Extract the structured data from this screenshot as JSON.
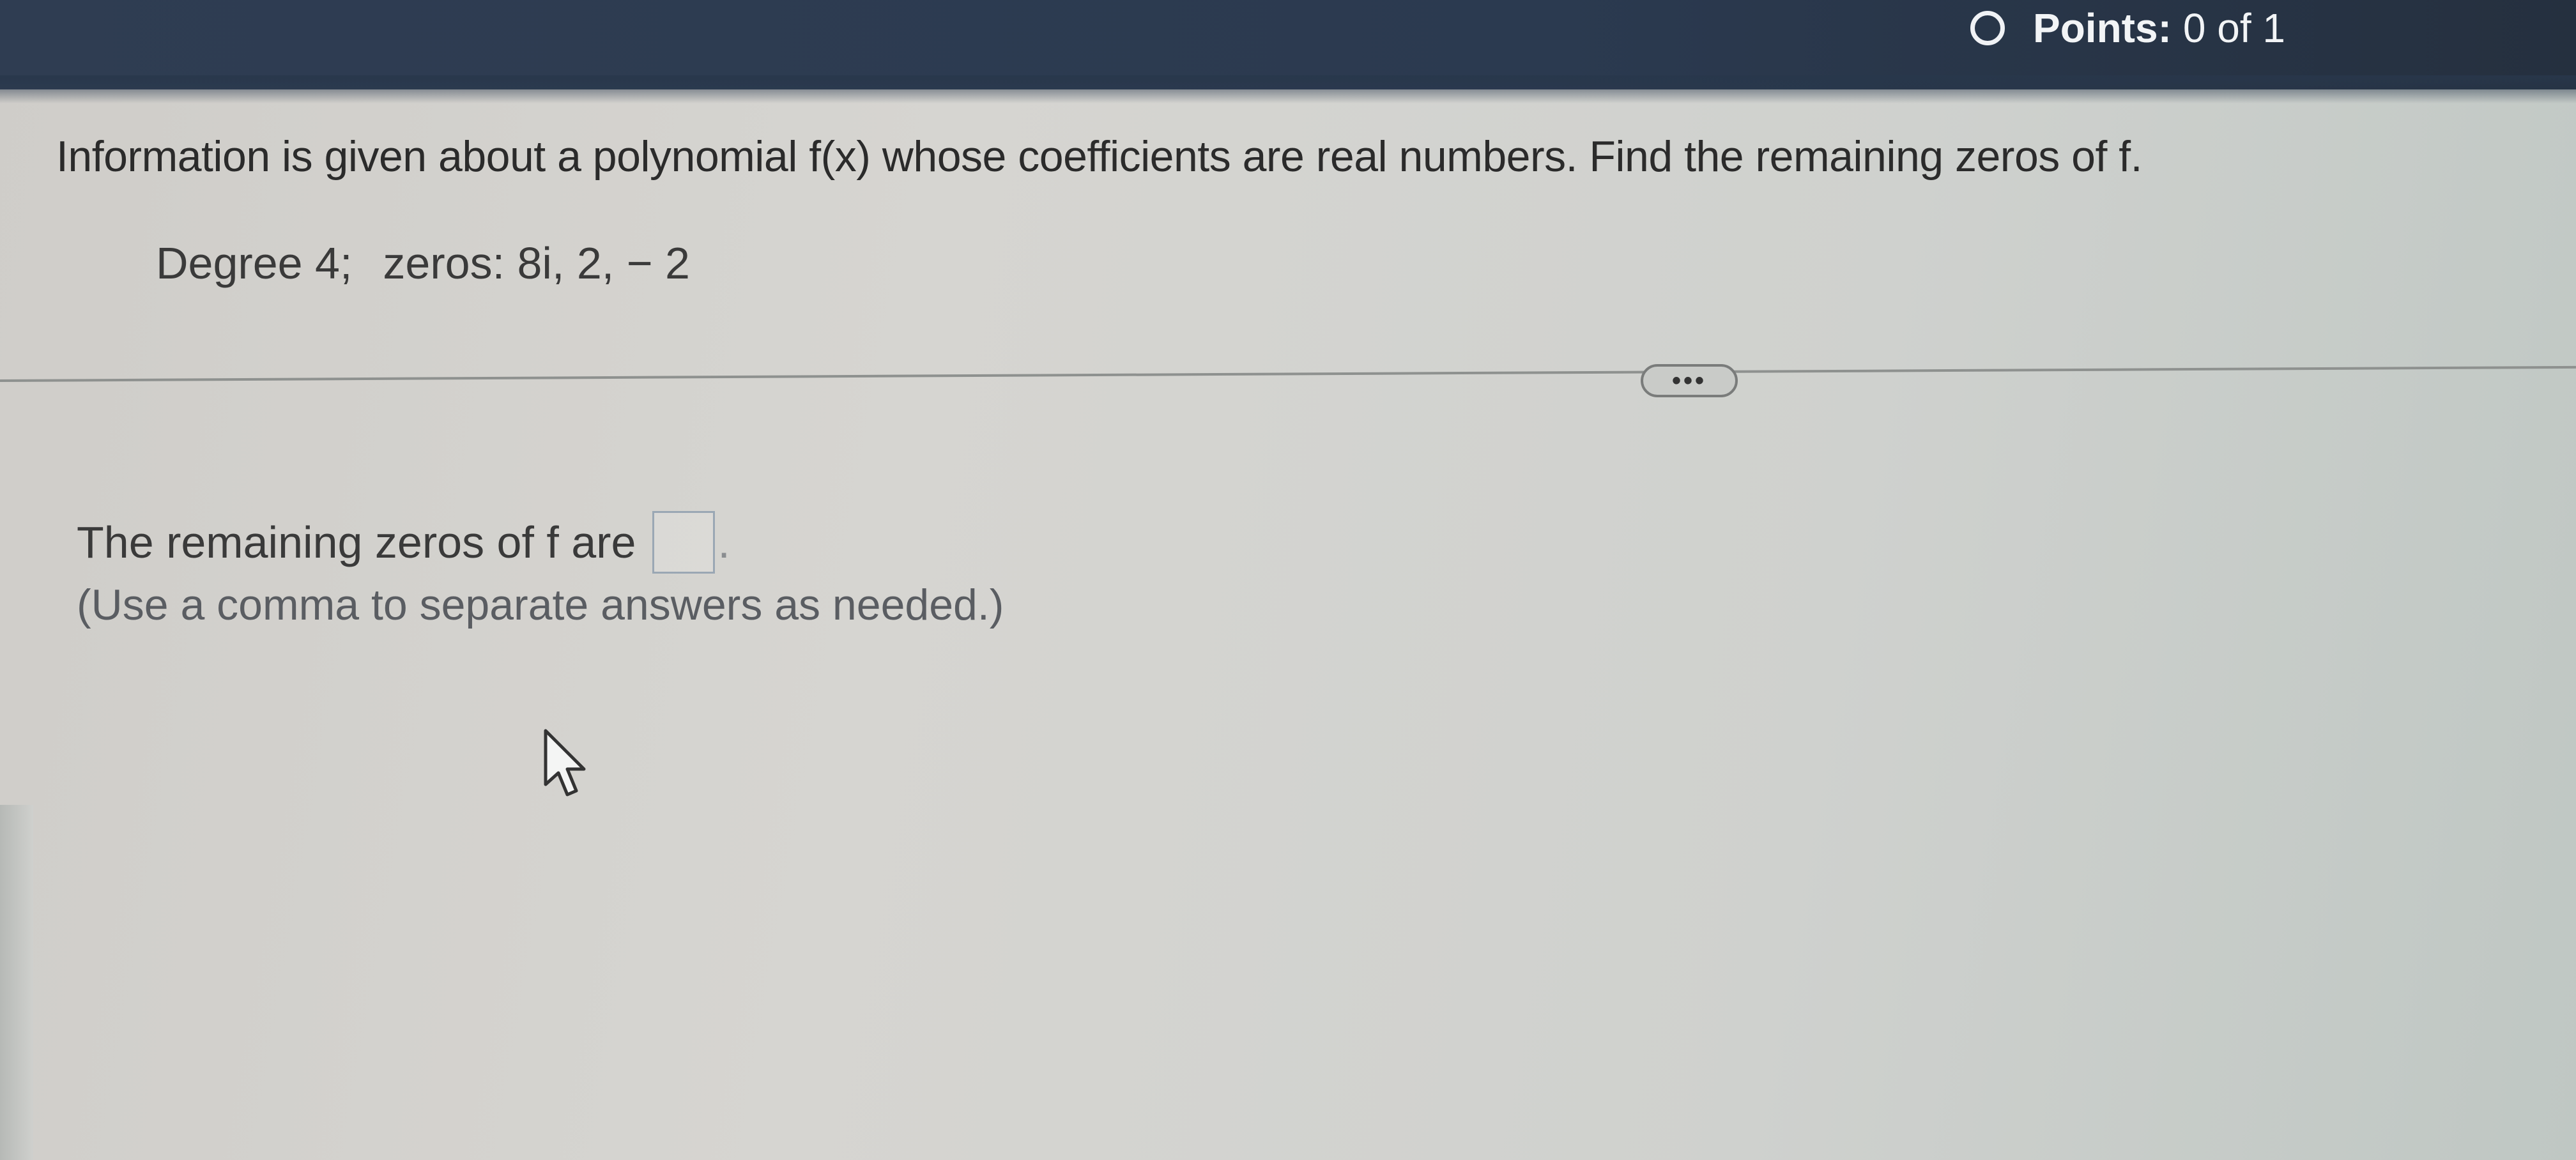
{
  "header": {
    "points_label": "Points:",
    "points_value": "0 of 1"
  },
  "question": {
    "prompt": "Information is given about a polynomial f(x) whose coefficients are real numbers. Find the remaining zeros of f.",
    "degree": "Degree 4;",
    "zeros": "zeros: 8i, 2, − 2"
  },
  "toolbar": {
    "more_label": "•••"
  },
  "answer": {
    "label": "The remaining zeros of f are",
    "value": "",
    "period": ".",
    "hint": "(Use a comma to separate answers as needed.)"
  },
  "colors": {
    "header_bg": "#2f3d52",
    "page_bg": "#d3d2ce",
    "text": "#2b2b2b"
  },
  "icons": {
    "status": "radio-empty-icon",
    "cursor": "mouse-pointer-icon"
  }
}
